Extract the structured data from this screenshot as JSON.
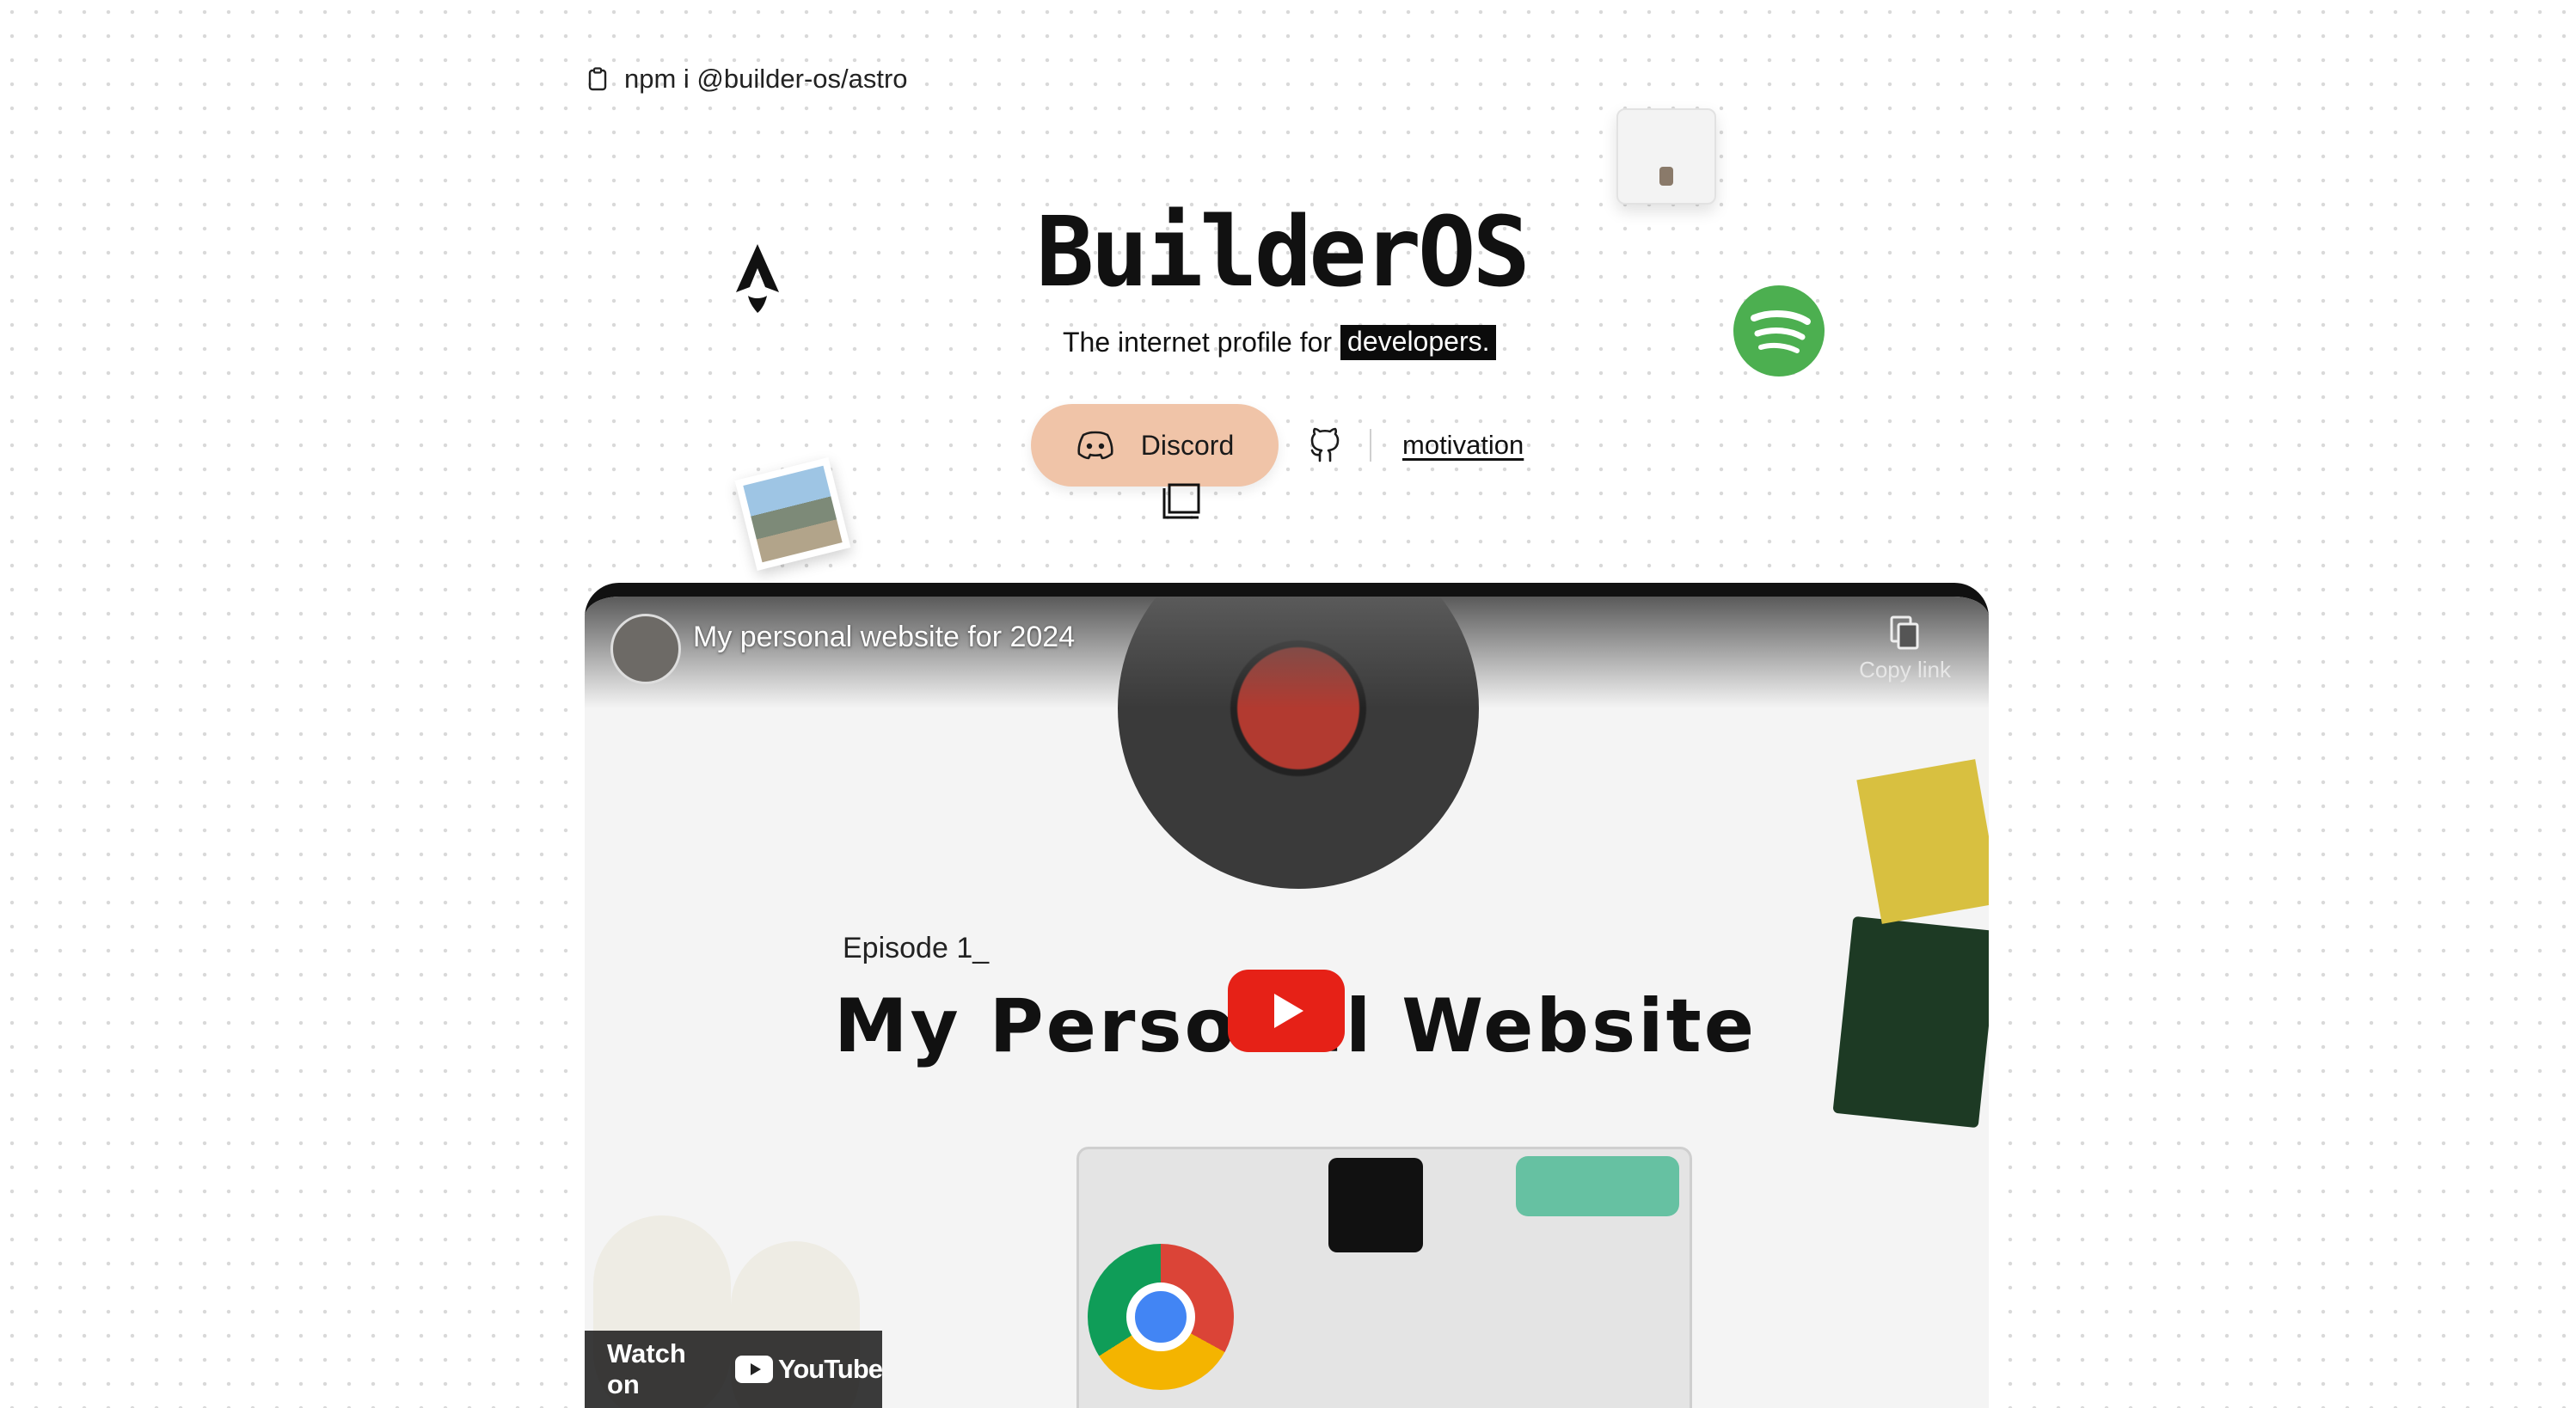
{
  "install": {
    "command": "npm i @builder-os/astro",
    "icon": "clipboard-icon"
  },
  "brand": {
    "name": "BuilderOS"
  },
  "tagline": {
    "prefix": "The internet profile for",
    "highlight": "developers."
  },
  "actions": {
    "discord_label": "Discord",
    "github_icon": "github-icon",
    "motivation_label": "motivation"
  },
  "video": {
    "title": "My personal website for 2024",
    "copy_link_label": "Copy link",
    "episode": "Episode 1_",
    "headline": "My Personal Website",
    "watch_on": "Watch on",
    "platform": "YouTube"
  },
  "colors": {
    "discord_bg": "#f0c4a8",
    "spotify": "#4caf50",
    "youtube_red": "#e62117"
  }
}
